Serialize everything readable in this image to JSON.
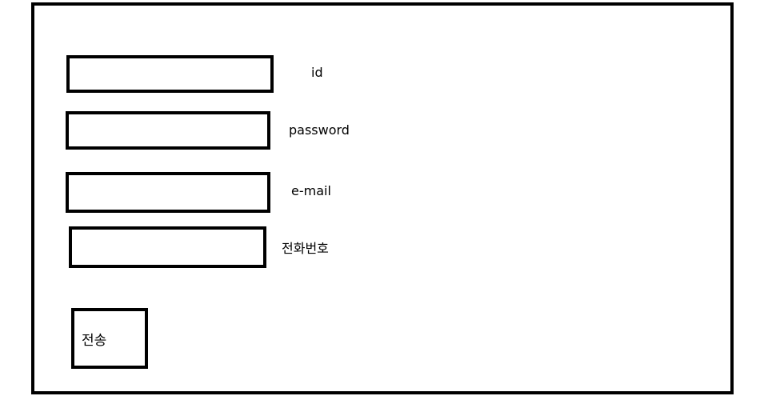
{
  "form": {
    "fields": [
      {
        "name": "id",
        "label": "id",
        "value": ""
      },
      {
        "name": "password",
        "label": "password",
        "value": ""
      },
      {
        "name": "email",
        "label": "e-mail",
        "value": ""
      },
      {
        "name": "phone",
        "label": "전화번호",
        "value": ""
      }
    ],
    "submit_label": "전송"
  }
}
